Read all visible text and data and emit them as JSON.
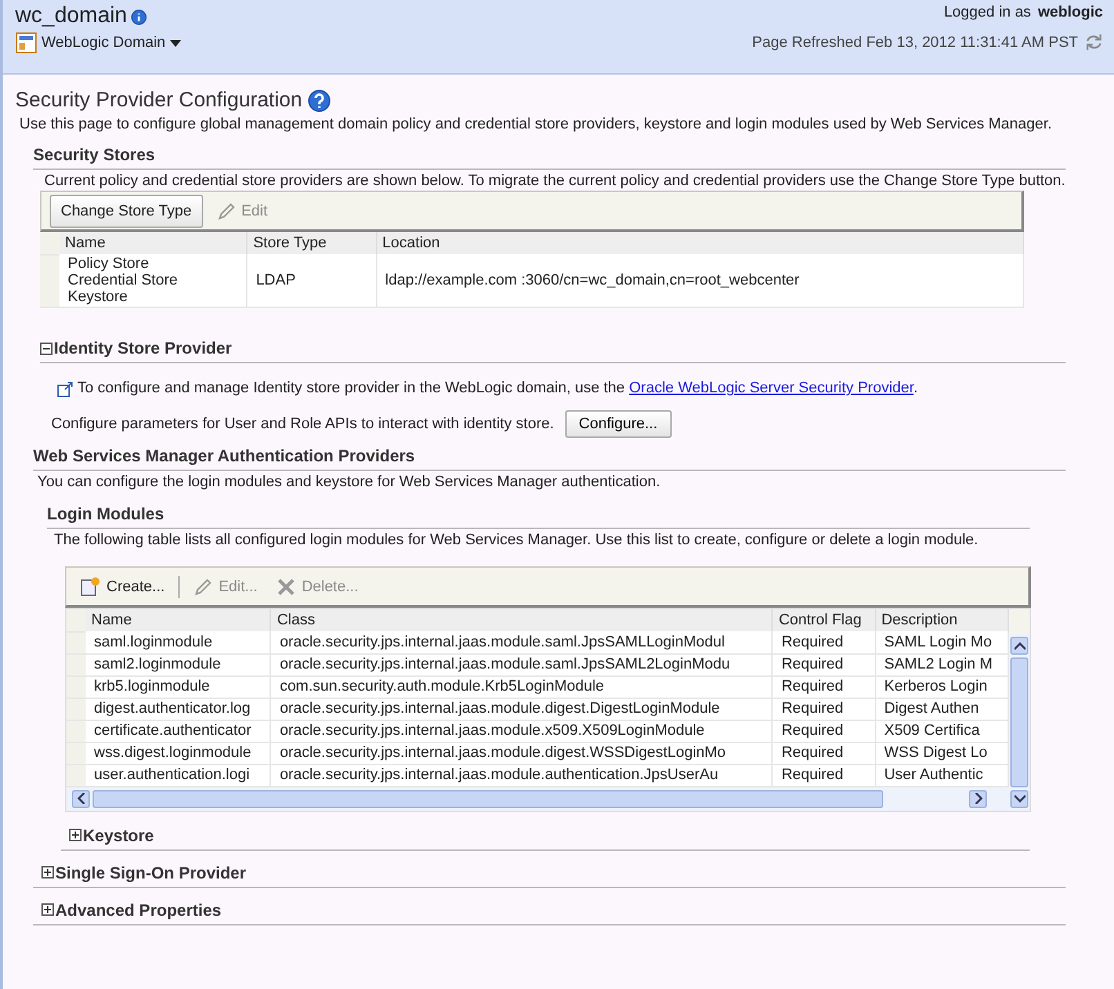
{
  "header": {
    "title": "wc_domain",
    "menu": "WebLogic Domain",
    "user_label": "Logged in as",
    "user": "weblogic",
    "refreshed": "Page Refreshed Feb 13, 2012 11:31:41 AM PST"
  },
  "page": {
    "title": "Security Provider Configuration",
    "description": "Use this page to configure global management domain policy and credential store providers, keystore and login modules used by Web Services Manager."
  },
  "security_stores": {
    "heading": "Security Stores",
    "description": "Current policy and credential store providers are shown below. To migrate the current policy and credential providers use the Change Store Type button.",
    "toolbar": [
      {
        "label": "Change Store Type",
        "kind": "button",
        "disabled": false
      },
      {
        "label": "Edit",
        "kind": "edit",
        "disabled": true
      }
    ],
    "columns": [
      "Name",
      "Store Type",
      "Location"
    ],
    "rows": [
      {
        "names": [
          "Policy Store",
          "Credential Store",
          "Keystore"
        ],
        "store_type": "LDAP",
        "location": "ldap://example.com :3060/cn=wc_domain,cn=root_webcenter"
      }
    ]
  },
  "identity_store": {
    "heading": "Identity Store Provider",
    "expanded": true,
    "text": "To configure and manage Identity store provider in the WebLogic domain, use the",
    "link": "Oracle WebLogic Server Security Provider",
    "link_suffix": ".",
    "configure_text": "Configure parameters for User and Role APIs to interact with identity store.",
    "configure_button": "Configure..."
  },
  "wsm": {
    "heading": "Web Services Manager Authentication Providers",
    "description": "You can configure the login modules and keystore for Web Services Manager authentication."
  },
  "login_modules": {
    "heading": "Login Modules",
    "description": "The following table lists all configured login modules for Web Services Manager. Use this list to create, configure or delete a login module.",
    "toolbar": [
      {
        "label": "Create...",
        "kind": "create",
        "disabled": false
      },
      {
        "label": "Edit...",
        "kind": "edit",
        "disabled": true
      },
      {
        "label": "Delete...",
        "kind": "delete",
        "disabled": true
      }
    ],
    "columns": [
      "Name",
      "Class",
      "Control Flag",
      "Description"
    ],
    "rows": [
      {
        "name": "saml.loginmodule",
        "class": "oracle.security.jps.internal.jaas.module.saml.JpsSAMLLoginModul",
        "flag": "Required",
        "description": "SAML Login Mo"
      },
      {
        "name": "saml2.loginmodule",
        "class": "oracle.security.jps.internal.jaas.module.saml.JpsSAML2LoginModu",
        "flag": "Required",
        "description": "SAML2 Login M"
      },
      {
        "name": "krb5.loginmodule",
        "class": "com.sun.security.auth.module.Krb5LoginModule",
        "flag": "Required",
        "description": "Kerberos Login"
      },
      {
        "name": "digest.authenticator.log",
        "class": "oracle.security.jps.internal.jaas.module.digest.DigestLoginModule",
        "flag": "Required",
        "description": "Digest Authen"
      },
      {
        "name": "certificate.authenticator",
        "class": "oracle.security.jps.internal.jaas.module.x509.X509LoginModule",
        "flag": "Required",
        "description": "X509 Certifica"
      },
      {
        "name": "wss.digest.loginmodule",
        "class": "oracle.security.jps.internal.jaas.module.digest.WSSDigestLoginMo",
        "flag": "Required",
        "description": "WSS Digest Lo"
      },
      {
        "name": "user.authentication.logi",
        "class": "oracle.security.jps.internal.jaas.module.authentication.JpsUserAu",
        "flag": "Required",
        "description": "User Authentic"
      }
    ]
  },
  "keystore": {
    "heading": "Keystore",
    "expanded": false
  },
  "sections": [
    {
      "heading": "Single Sign-On Provider",
      "expanded": false
    },
    {
      "heading": "Advanced Properties",
      "expanded": false
    }
  ]
}
